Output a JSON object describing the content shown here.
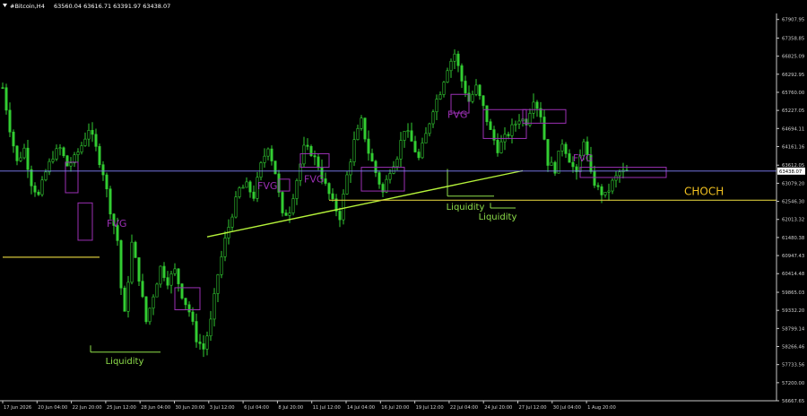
{
  "header": {
    "symbol": "#Bitcoin,H4",
    "ohlc": "63560.04 63616.71 63391.97 63438.07"
  },
  "colors": {
    "background": "#000000",
    "bull": "#32cd32",
    "bear": "#32cd32",
    "axis": "#c8c8c8",
    "fvg": "#9b30b4",
    "liquidity": "#8fe04b",
    "trendline": "#b5f23a",
    "level": "#d4c53a",
    "price_line": "#8282ff",
    "choch": "#f0c020"
  },
  "chart_data": {
    "type": "candlestick",
    "title": "",
    "xlabel": "",
    "ylabel": "",
    "ylim": [
      56667.65,
      68085.0
    ],
    "y_ticks": [
      "67907.95",
      "67358.85",
      "66825.09",
      "66292.95",
      "65760.00",
      "65227.05",
      "64694.11",
      "64161.16",
      "63612.05",
      "63079.20",
      "62546.30",
      "62013.32",
      "61480.38",
      "60947.43",
      "60414.48",
      "59865.03",
      "59332.20",
      "58799.14",
      "58266.46",
      "57733.56",
      "57200.00",
      "56667.65"
    ],
    "x_ticks": [
      "17 Jun 2026",
      "20 Jun 04:00",
      "22 Jun 20:00",
      "25 Jun 12:00",
      "28 Jun 04:00",
      "30 Jun 20:00",
      "3 Jul 12:00",
      "6 Jul 04:00",
      "8 Jul 20:00",
      "11 Jul 12:00",
      "14 Jul 04:00",
      "16 Jul 20:00",
      "19 Jul 12:00",
      "22 Jul 04:00",
      "24 Jul 20:00",
      "27 Jul 12:00",
      "30 Jul 04:00",
      "1 Aug 20:00"
    ],
    "current_price": 63438.07,
    "close_path": [
      [
        0,
        65900
      ],
      [
        2,
        64700
      ],
      [
        4,
        63700
      ],
      [
        6,
        64100
      ],
      [
        8,
        63100
      ],
      [
        10,
        62700
      ],
      [
        12,
        63400
      ],
      [
        14,
        63900
      ],
      [
        16,
        64100
      ],
      [
        18,
        63600
      ],
      [
        20,
        63800
      ],
      [
        22,
        64200
      ],
      [
        24,
        64700
      ],
      [
        26,
        64100
      ],
      [
        28,
        63400
      ],
      [
        30,
        62300
      ],
      [
        32,
        61400
      ],
      [
        33,
        60000
      ],
      [
        34,
        59200
      ],
      [
        36,
        61300
      ],
      [
        38,
        60300
      ],
      [
        40,
        59000
      ],
      [
        42,
        59800
      ],
      [
        44,
        60600
      ],
      [
        46,
        60200
      ],
      [
        48,
        60500
      ],
      [
        50,
        59800
      ],
      [
        52,
        59300
      ],
      [
        54,
        58500
      ],
      [
        56,
        58200
      ],
      [
        58,
        59000
      ],
      [
        60,
        60400
      ],
      [
        62,
        61400
      ],
      [
        64,
        62200
      ],
      [
        66,
        62900
      ],
      [
        68,
        63000
      ],
      [
        70,
        62700
      ],
      [
        72,
        63600
      ],
      [
        74,
        64200
      ],
      [
        76,
        63400
      ],
      [
        78,
        62100
      ],
      [
        80,
        62300
      ],
      [
        82,
        63200
      ],
      [
        84,
        64100
      ],
      [
        86,
        64000
      ],
      [
        88,
        63600
      ],
      [
        90,
        63000
      ],
      [
        92,
        62500
      ],
      [
        94,
        62100
      ],
      [
        96,
        63300
      ],
      [
        98,
        64300
      ],
      [
        100,
        64900
      ],
      [
        102,
        64000
      ],
      [
        104,
        63400
      ],
      [
        106,
        62800
      ],
      [
        108,
        63500
      ],
      [
        110,
        63900
      ],
      [
        112,
        64700
      ],
      [
        114,
        64300
      ],
      [
        116,
        63800
      ],
      [
        118,
        64500
      ],
      [
        120,
        65300
      ],
      [
        122,
        65800
      ],
      [
        124,
        66500
      ],
      [
        126,
        66900
      ],
      [
        128,
        66100
      ],
      [
        130,
        65500
      ],
      [
        132,
        65900
      ],
      [
        134,
        65300
      ],
      [
        136,
        64600
      ],
      [
        138,
        64100
      ],
      [
        140,
        64400
      ],
      [
        142,
        64700
      ],
      [
        144,
        65000
      ],
      [
        146,
        64900
      ],
      [
        148,
        65600
      ],
      [
        150,
        65100
      ],
      [
        152,
        63700
      ],
      [
        154,
        63500
      ],
      [
        156,
        64300
      ],
      [
        158,
        63800
      ],
      [
        160,
        63300
      ],
      [
        162,
        64400
      ],
      [
        164,
        63300
      ],
      [
        166,
        62900
      ],
      [
        168,
        62700
      ],
      [
        170,
        63100
      ],
      [
        172,
        63400
      ]
    ],
    "annotations": {
      "fvg_label": "FVG",
      "liquidity_label": "Liquidity",
      "choch_label": "CHOCH",
      "fvg_zones": [
        {
          "from": 17.5,
          "to": 21,
          "low": 62800,
          "high": 63700
        },
        {
          "from": 21,
          "to": 25,
          "low": 61400,
          "high": 62500
        },
        {
          "from": 48,
          "to": 55,
          "low": 60000,
          "high": 59350
        },
        {
          "from": 77,
          "to": 80,
          "low": 62850,
          "high": 63200
        },
        {
          "from": 83,
          "to": 91,
          "low": 63550,
          "high": 63950
        },
        {
          "from": 100,
          "to": 112,
          "low": 62850,
          "high": 63550
        },
        {
          "from": 125,
          "to": 130,
          "low": 65150,
          "high": 65700
        },
        {
          "from": 134,
          "to": 146,
          "low": 64400,
          "high": 65250
        },
        {
          "from": 145,
          "to": 157,
          "low": 64850,
          "high": 65250
        },
        {
          "from": 161,
          "to": 185,
          "low": 63250,
          "high": 63550
        }
      ],
      "fvg_texts": [
        {
          "at": 29,
          "price": 61800
        },
        {
          "at": 71,
          "price": 62900
        },
        {
          "at": 84,
          "price": 63100
        },
        {
          "at": 124,
          "price": 65000
        },
        {
          "at": 159,
          "price": 63720
        }
      ],
      "liquidity_zones": [
        {
          "from": 24.5,
          "to": 44,
          "low": 58100,
          "high": 58300
        },
        {
          "from": 124,
          "to": 137,
          "low": 62700,
          "high": 63500
        },
        {
          "from": 136,
          "to": 143,
          "low": 62350,
          "high": 62500
        }
      ],
      "liquidity_texts": [
        {
          "at": 34,
          "price": 57750
        },
        {
          "at": 129,
          "price": 62300
        },
        {
          "at": 138,
          "price": 62000
        }
      ],
      "trendline": {
        "x1": 57,
        "y1": 61500,
        "x2": 145,
        "y2": 63450
      },
      "level_left": {
        "x1": 0,
        "x2": 27,
        "price": 60900
      },
      "level_right": {
        "x1": 91,
        "x2": 174,
        "price": 62580
      },
      "choch_at": {
        "x": 160,
        "price": 62730
      }
    }
  }
}
